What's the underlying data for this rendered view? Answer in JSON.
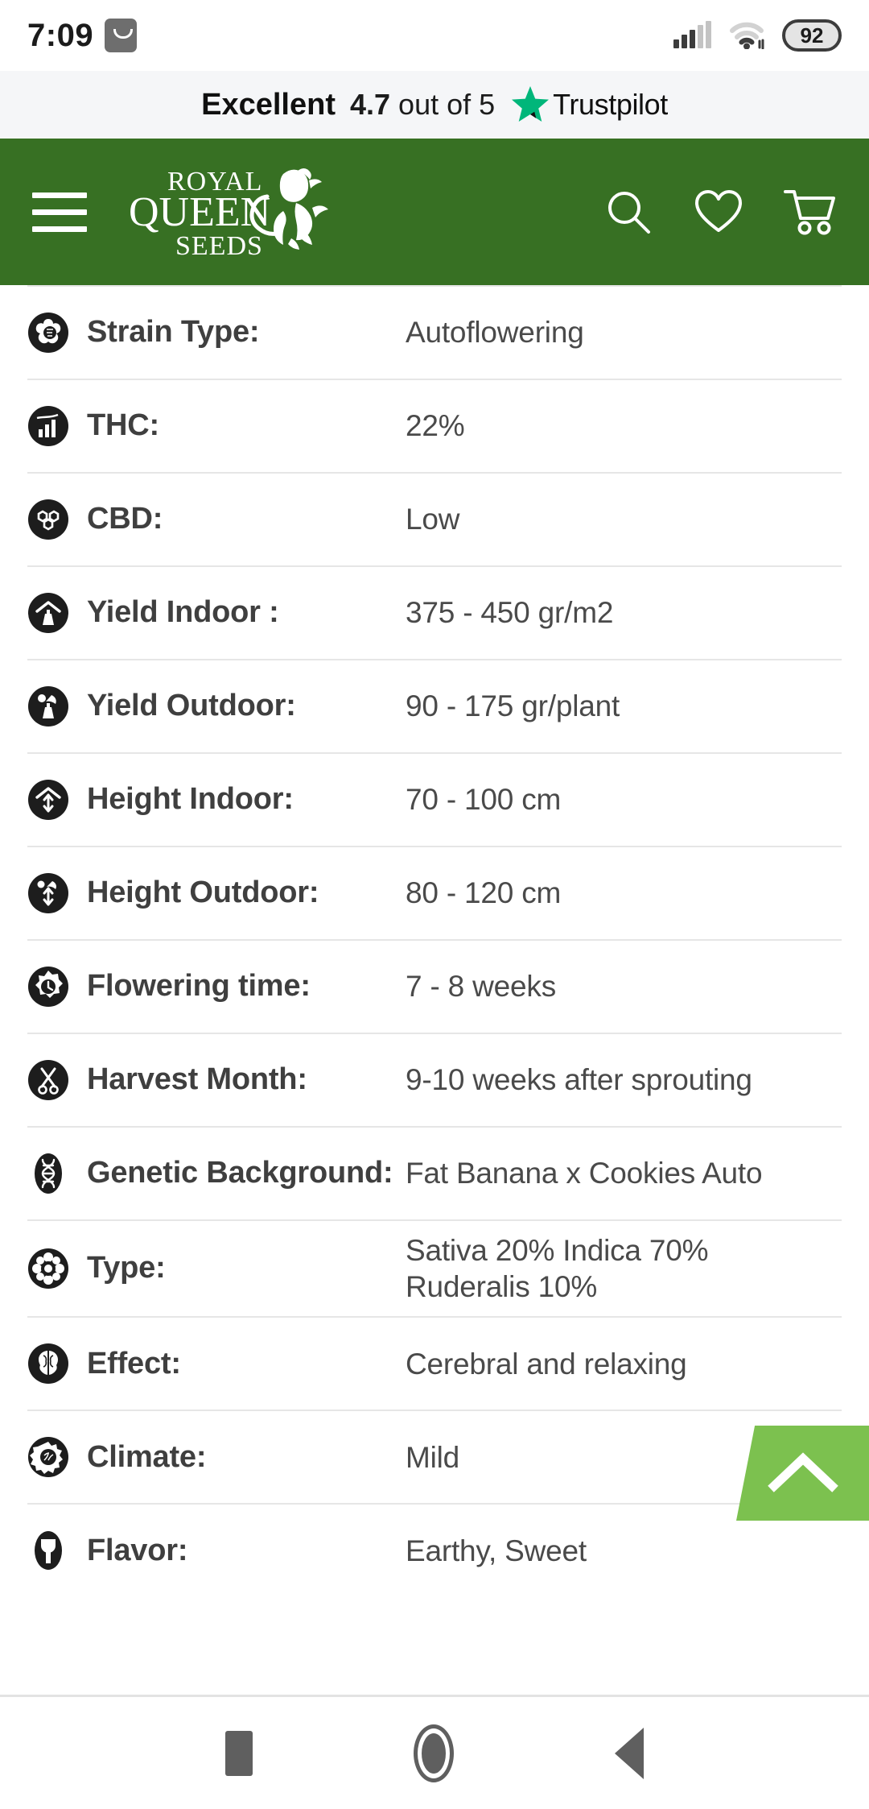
{
  "status_bar": {
    "time": "7:09",
    "app_icon": "shopping-bag-icon",
    "signal_icon": "cellular-signal-icon",
    "wifi_icon": "wifi-icon",
    "battery_level": "92"
  },
  "trustpilot": {
    "label": "Excellent",
    "score": "4.7",
    "out_of": " out of 5",
    "star_icon": "trustpilot-star-icon",
    "brand": "Trustpilot",
    "star_color": "#00b67a",
    "bar_background": "#f5f6f8"
  },
  "header": {
    "background": "#377023",
    "menu_icon": "hamburger-menu-icon",
    "logo_line1": "ROYAL",
    "logo_line2": "QUEEN",
    "logo_line3": "SEEDS",
    "logo_alt": "royal-queen-seeds-lion-logo",
    "search_icon": "search-icon",
    "wishlist_icon": "heart-icon",
    "cart_icon": "shopping-cart-icon"
  },
  "specs": [
    {
      "icon": "flower-bud-icon",
      "label": "Strain Type:",
      "value": "Autoflowering"
    },
    {
      "icon": "bar-chart-icon",
      "label": "THC:",
      "value": "22%"
    },
    {
      "icon": "molecule-icon",
      "label": "CBD:",
      "value": "Low"
    },
    {
      "icon": "indoor-yield-icon",
      "label": "Yield Indoor :",
      "value": "375 - 450 gr/m2"
    },
    {
      "icon": "outdoor-yield-icon",
      "label": "Yield Outdoor:",
      "value": "90 - 175 gr/plant"
    },
    {
      "icon": "indoor-height-icon",
      "label": "Height Indoor:",
      "value": "70 - 100 cm"
    },
    {
      "icon": "outdoor-height-icon",
      "label": "Height Outdoor:",
      "value": "80 - 120 cm"
    },
    {
      "icon": "clock-flower-icon",
      "label": "Flowering time:",
      "value": "7 - 8 weeks"
    },
    {
      "icon": "scissors-icon",
      "label": "Harvest Month:",
      "value": "9-10 weeks after sprouting"
    },
    {
      "icon": "dna-helix-icon",
      "label": "Genetic Background:",
      "value": "Fat Banana x Cookies Auto"
    },
    {
      "icon": "type-flower-icon",
      "label": "Type:",
      "value": "Sativa 20% Indica 70%\nRuderalis 10%"
    },
    {
      "icon": "brain-icon",
      "label": "Effect:",
      "value": "Cerebral and relaxing"
    },
    {
      "icon": "sun-climate-icon",
      "label": "Climate:",
      "value": "Mild"
    },
    {
      "icon": "flavor-drop-icon",
      "label": "Flavor:",
      "value": "Earthy, Sweet"
    }
  ],
  "scroll_top_button": {
    "icon": "chevron-up-icon",
    "color": "#7cc14f"
  },
  "android_nav": {
    "recents_icon": "square-recents-icon",
    "home_icon": "circle-home-icon",
    "back_icon": "triangle-back-icon"
  }
}
